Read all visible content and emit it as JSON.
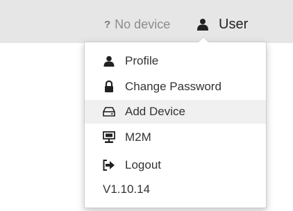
{
  "topbar": {
    "device_status_icon": "question-mark",
    "device_status_icon_glyph": "?",
    "device_status_text": "No device",
    "user_icon": "user-icon",
    "user_label": "User"
  },
  "menu": {
    "items": [
      {
        "icon": "user-icon",
        "label": "Profile"
      },
      {
        "icon": "lock-icon",
        "label": "Change Password"
      },
      {
        "icon": "device-icon",
        "label": "Add Device"
      },
      {
        "icon": "m2m-icon",
        "label": "M2M"
      },
      {
        "icon": "logout-icon",
        "label": "Logout"
      }
    ],
    "version": "V1.10.14"
  },
  "colors": {
    "topbar_bg": "#e6e6e6",
    "hover_bg": "#f0f0f0",
    "text": "#333333"
  }
}
